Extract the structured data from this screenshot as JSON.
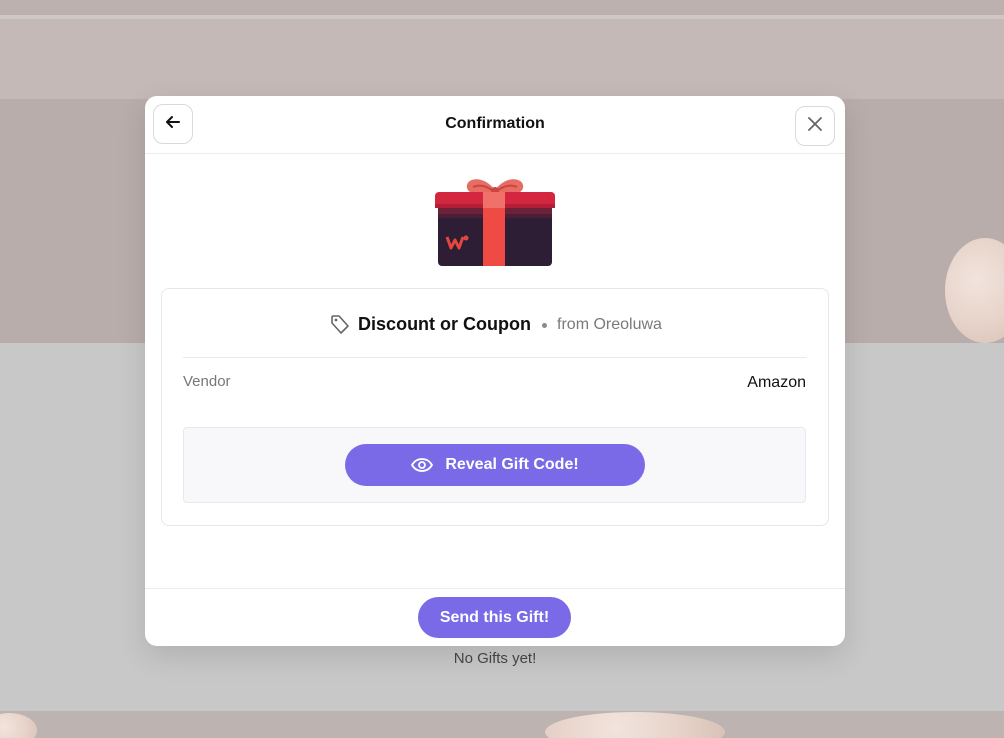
{
  "background": {
    "empty_state": "No Gifts yet!"
  },
  "modal": {
    "title": "Confirmation",
    "back_icon": "arrow-left-icon",
    "close_icon": "close-icon"
  },
  "gift": {
    "image": "gift-box-illustration",
    "brand_mark": "W"
  },
  "card": {
    "icon": "tag-icon",
    "type": "Discount or Coupon",
    "from": "from Oreoluwa",
    "vendor_label": "Vendor",
    "vendor_value": "Amazon",
    "reveal_label": "Reveal Gift Code!",
    "reveal_icon": "eye-icon"
  },
  "footer": {
    "send_label": "Send this Gift!"
  },
  "colors": {
    "accent": "#7b6ae8",
    "gift_primary": "#2e1e35",
    "gift_ribbon": "#ef4a44"
  }
}
